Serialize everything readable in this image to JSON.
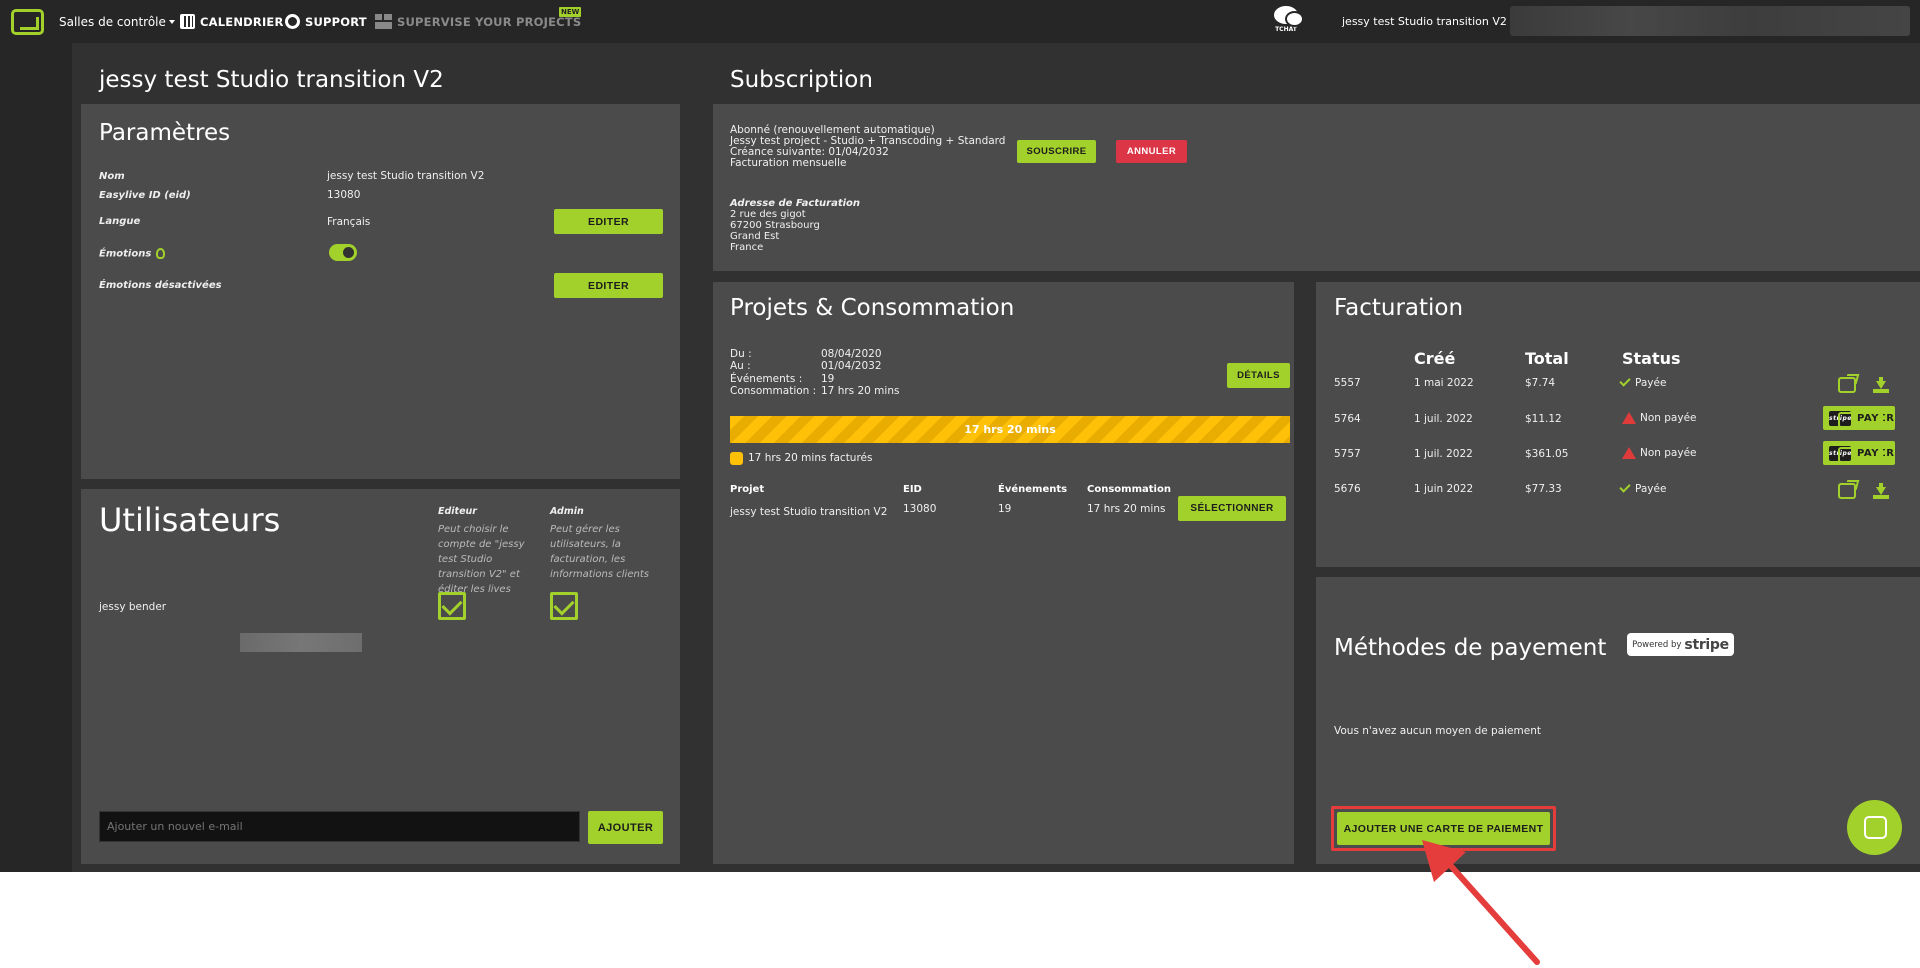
{
  "topbar": {
    "salles": "Salles de contrôle",
    "calendrier": "CALENDRIER",
    "support": "SUPPORT",
    "supervise": "SUPERVISE YOUR PROJECTS",
    "new_badge": "NEW",
    "tchat": "TCHAT",
    "account": "jessy test Studio transition V2"
  },
  "page_title": "jessy test Studio transition V2",
  "parametres": {
    "title": "Paramètres",
    "nom_label": "Nom",
    "nom_value": "jessy test Studio transition V2",
    "eid_label": "Easylive ID (eid)",
    "eid_value": "13080",
    "langue_label": "Langue",
    "langue_value": "Français",
    "editer": "EDITER",
    "emotions_label": "Émotions",
    "emotions_off_label": "Émotions désactivées",
    "editer2": "EDITER"
  },
  "utilisateurs": {
    "title": "Utilisateurs",
    "editeur_label": "Editeur",
    "editeur_desc": "Peut choisir le compte de \"jessy test Studio transition V2\" et éditer les lives",
    "admin_label": "Admin",
    "admin_desc": "Peut gérer les utilisateurs, la facturation, les informations clients",
    "user_name": "jessy bender",
    "input_placeholder": "Ajouter un nouvel e-mail",
    "ajouter": "AJOUTER"
  },
  "subscription": {
    "title": "Subscription",
    "line1": "Abonné (renouvellement automatique)",
    "line2": "Jessy test project - Studio + Transcoding + Standard",
    "line3": "Créance suivante: 01/04/2032",
    "line4": "Facturation mensuelle",
    "souscrire": "SOUSCRIRE",
    "annuler": "ANNULER",
    "addr_label": "Adresse de Facturation",
    "addr1": "2 rue des gigot",
    "addr2": "67200 Strasbourg",
    "addr3": "Grand Est",
    "addr4": "France"
  },
  "projets": {
    "title": "Projets & Consommation",
    "du_label": "Du :",
    "du_value": "08/04/2020",
    "au_label": "Au :",
    "au_value": "01/04/2032",
    "evt_label": "Événements :",
    "evt_value": "19",
    "conso_label": "Consommation :",
    "conso_value": "17 hrs 20 mins",
    "details": "DÉTAILS",
    "progress_label": "17 hrs 20 mins",
    "progress_fraction": 1.0,
    "legend": "17 hrs 20 mins facturés",
    "col_projet": "Projet",
    "col_eid": "EID",
    "col_evt": "Événements",
    "col_conso": "Consommation",
    "row_projet": "jessy test Studio transition V2",
    "row_eid": "13080",
    "row_evt": "19",
    "row_conso": "17 hrs 20 mins",
    "selectionner": "SÉLECTIONNER"
  },
  "facturation": {
    "title": "Facturation",
    "col_cree": "Créé",
    "col_total": "Total",
    "col_status": "Status",
    "rows": [
      {
        "id": "5557",
        "date": "1 mai 2022",
        "total": "$7.74",
        "status": "Payée",
        "paid": true
      },
      {
        "id": "5764",
        "date": "1 juil. 2022",
        "total": "$11.12",
        "status": "Non payée",
        "paid": false
      },
      {
        "id": "5757",
        "date": "1 juil. 2022",
        "total": "$361.05",
        "status": "Non payée",
        "paid": false
      },
      {
        "id": "5676",
        "date": "1 juin 2022",
        "total": "$77.33",
        "status": "Payée",
        "paid": true
      }
    ],
    "payer": "PAYER",
    "stripe_mini": "stripe"
  },
  "methodes": {
    "title": "Méthodes de payement",
    "powered_by": "Powered by",
    "stripe": "stripe",
    "empty": "Vous n'avez aucun moyen de paiement",
    "add_card": "AJOUTER UNE CARTE DE PAIEMENT"
  },
  "colors": {
    "accent": "#a2d12b",
    "danger": "#dc3545",
    "warning": "#ffc107",
    "highlight": "#e53c3c"
  }
}
